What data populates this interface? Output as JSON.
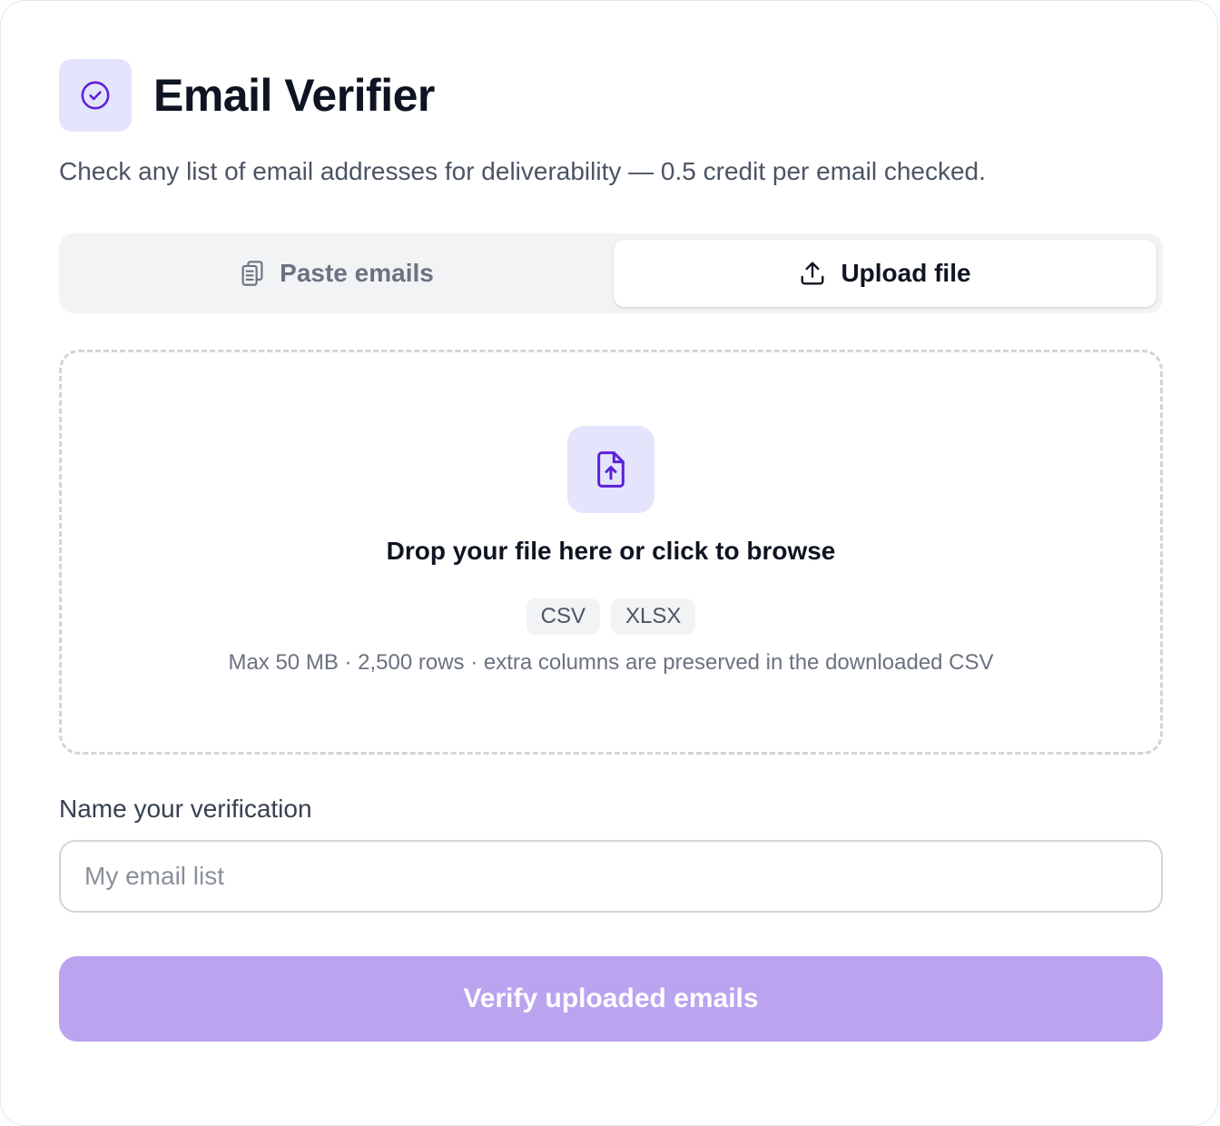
{
  "header": {
    "title": "Email Verifier",
    "subtitle": "Check any list of email addresses for deliverability — 0.5 credit per email checked.",
    "icon": "check-circle-icon"
  },
  "tabs": [
    {
      "label": "Paste emails",
      "icon": "clipboard-icon",
      "active": false
    },
    {
      "label": "Upload file",
      "icon": "upload-icon",
      "active": true
    }
  ],
  "dropzone": {
    "icon": "file-upload-icon",
    "title": "Drop your file here or click to browse",
    "formats": [
      "CSV",
      "XLSX"
    ],
    "hint": "Max 50 MB · 2,500 rows · extra columns are preserved in the downloaded CSV"
  },
  "name_field": {
    "label": "Name your verification",
    "value": "",
    "placeholder": "My email list"
  },
  "submit": {
    "label": "Verify uploaded emails",
    "disabled": true
  },
  "colors": {
    "accent": "#5b21d6",
    "accent_soft": "#e4e4fd",
    "button_disabled": "#baa3ef",
    "heading": "#0f1422",
    "muted": "#6b7280"
  }
}
